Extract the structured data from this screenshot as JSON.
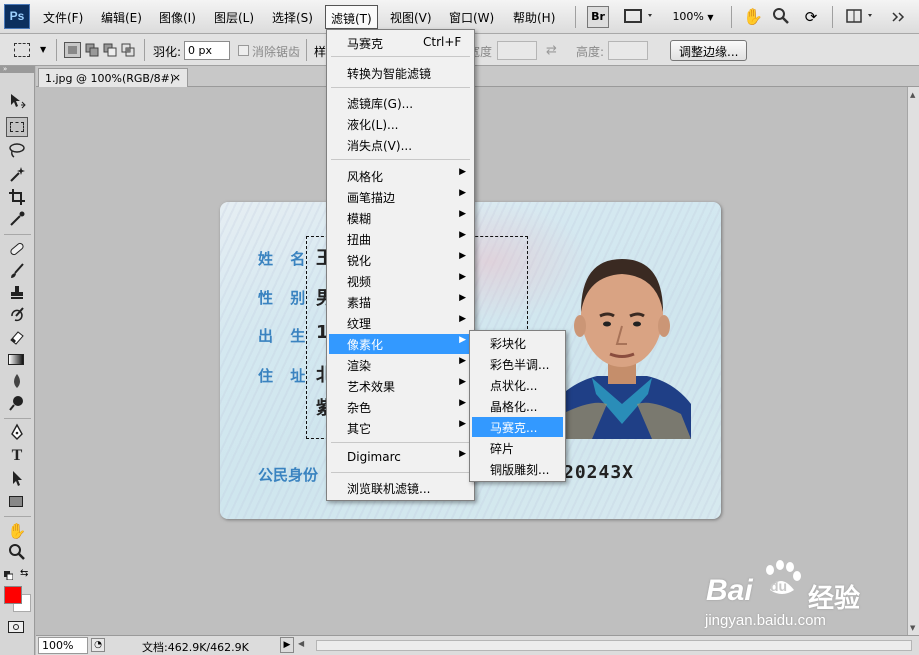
{
  "app": {
    "logo": "Ps"
  },
  "menubar": {
    "items": [
      "文件(F)",
      "编辑(E)",
      "图像(I)",
      "图层(L)",
      "选择(S)",
      "滤镜(T)",
      "视图(V)",
      "窗口(W)",
      "帮助(H)"
    ],
    "bridge": "Br",
    "zoom": "100%"
  },
  "options": {
    "feather_label": "羽化:",
    "feather_value": "0 px",
    "antialias_label": "消除锯齿",
    "style_label": "样",
    "width_label": "宽度:",
    "height_label": "高度:",
    "refine_button": "调整边缘..."
  },
  "document": {
    "tab": "1.jpg @ 100%(RGB/8#)",
    "close": "×"
  },
  "status": {
    "zoom": "100%",
    "doc_info": "文档:462.9K/462.9K"
  },
  "filter_menu": {
    "items": [
      {
        "label": "马赛克",
        "shortcut": "Ctrl+F"
      },
      {
        "label": "转换为智能滤镜"
      },
      {
        "label": "滤镜库(G)..."
      },
      {
        "label": "液化(L)..."
      },
      {
        "label": "消失点(V)..."
      },
      {
        "label": "风格化",
        "sub": true
      },
      {
        "label": "画笔描边",
        "sub": true
      },
      {
        "label": "模糊",
        "sub": true
      },
      {
        "label": "扭曲",
        "sub": true
      },
      {
        "label": "锐化",
        "sub": true
      },
      {
        "label": "视频",
        "sub": true
      },
      {
        "label": "素描",
        "sub": true
      },
      {
        "label": "纹理",
        "sub": true
      },
      {
        "label": "像素化",
        "sub": true,
        "highlight": true
      },
      {
        "label": "渲染",
        "sub": true
      },
      {
        "label": "艺术效果",
        "sub": true
      },
      {
        "label": "杂色",
        "sub": true
      },
      {
        "label": "其它",
        "sub": true
      },
      {
        "label": "Digimarc",
        "sub": true
      },
      {
        "label": "浏览联机滤镜..."
      }
    ]
  },
  "pixelate_submenu": {
    "items": [
      "彩块化",
      "彩色半调...",
      "点状化...",
      "晶格化...",
      "马赛克...",
      "碎片",
      "铜版雕刻..."
    ],
    "highlight_index": 4
  },
  "id_card": {
    "labels": [
      "姓 名",
      "性 别",
      "出 生",
      "住 址",
      "公民身份"
    ],
    "values": [
      "王",
      "男",
      "1",
      "北",
      "紫"
    ],
    "number_tail": "20243X"
  },
  "watermark": {
    "brand": "Bai",
    "brand2": "经验",
    "du": "du",
    "url": "jingyan.baidu.com"
  },
  "colors": {
    "foreground": "#ff0000",
    "background": "#ffffff",
    "highlight": "#3399ff"
  }
}
